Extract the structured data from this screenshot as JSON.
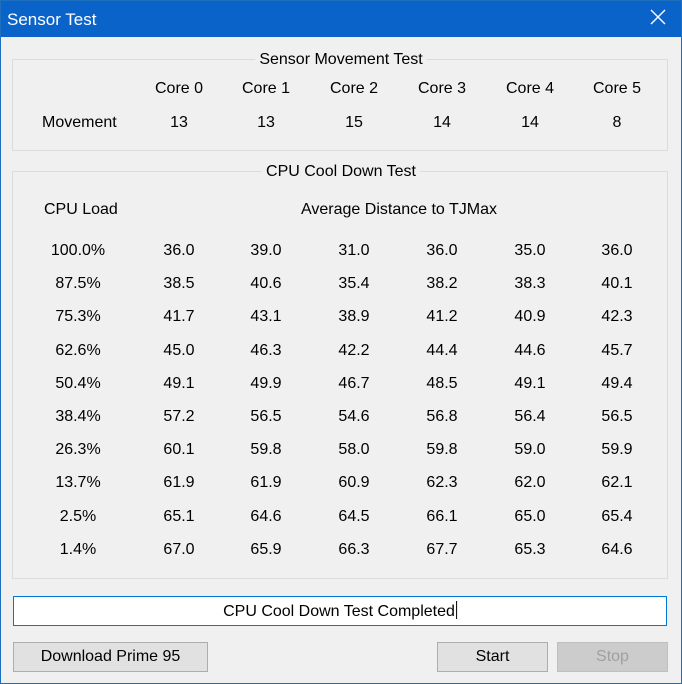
{
  "window": {
    "title": "Sensor Test"
  },
  "movement": {
    "legend": "Sensor Movement Test",
    "row_label": "Movement",
    "cores": [
      "Core 0",
      "Core 1",
      "Core 2",
      "Core 3",
      "Core 4",
      "Core 5"
    ],
    "values": [
      "13",
      "13",
      "15",
      "14",
      "14",
      "8"
    ]
  },
  "cooldown": {
    "legend": "CPU Cool Down Test",
    "load_header": "CPU Load",
    "distance_header": "Average Distance to TJMax",
    "rows": [
      {
        "load": "100.0%",
        "values": [
          "36.0",
          "39.0",
          "31.0",
          "36.0",
          "35.0",
          "36.0"
        ]
      },
      {
        "load": "87.5%",
        "values": [
          "38.5",
          "40.6",
          "35.4",
          "38.2",
          "38.3",
          "40.1"
        ]
      },
      {
        "load": "75.3%",
        "values": [
          "41.7",
          "43.1",
          "38.9",
          "41.2",
          "40.9",
          "42.3"
        ]
      },
      {
        "load": "62.6%",
        "values": [
          "45.0",
          "46.3",
          "42.2",
          "44.4",
          "44.6",
          "45.7"
        ]
      },
      {
        "load": "50.4%",
        "values": [
          "49.1",
          "49.9",
          "46.7",
          "48.5",
          "49.1",
          "49.4"
        ]
      },
      {
        "load": "38.4%",
        "values": [
          "57.2",
          "56.5",
          "54.6",
          "56.8",
          "56.4",
          "56.5"
        ]
      },
      {
        "load": "26.3%",
        "values": [
          "60.1",
          "59.8",
          "58.0",
          "59.8",
          "59.0",
          "59.9"
        ]
      },
      {
        "load": "13.7%",
        "values": [
          "61.9",
          "61.9",
          "60.9",
          "62.3",
          "62.0",
          "62.1"
        ]
      },
      {
        "load": "2.5%",
        "values": [
          "65.1",
          "64.6",
          "64.5",
          "66.1",
          "65.0",
          "65.4"
        ]
      },
      {
        "load": "1.4%",
        "values": [
          "67.0",
          "65.9",
          "66.3",
          "67.7",
          "65.3",
          "64.6"
        ]
      }
    ]
  },
  "status": {
    "text": "CPU Cool Down Test Completed"
  },
  "buttons": {
    "download": "Download Prime 95",
    "start": "Start",
    "stop": "Stop"
  },
  "colors": {
    "title_bar": "#0a63c9",
    "status_border": "#0078d7",
    "window_bg": "#f0f0f0"
  },
  "icons": {
    "close": "close-icon"
  }
}
